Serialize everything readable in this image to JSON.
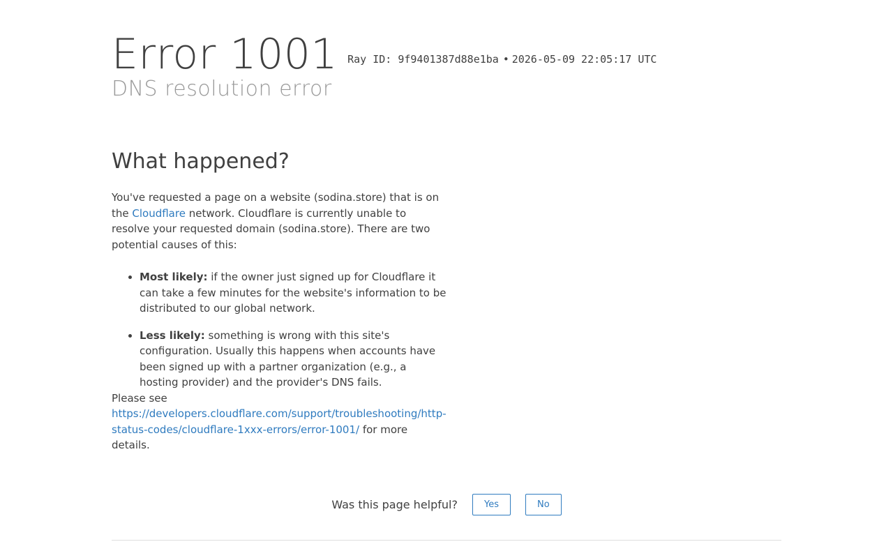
{
  "header": {
    "error_word": "Error",
    "error_code": "1001",
    "ray_label": "Ray ID:",
    "ray_id": "9f9401387d88e1ba",
    "separator": "•",
    "timestamp": "2026-05-09 22:05:17 UTC",
    "subtitle": "DNS resolution error"
  },
  "what_happened": {
    "heading": "What happened?",
    "para_part1": "You've requested a page on a website (sodina.store) that is on the ",
    "cloudflare_link": "Cloudflare",
    "para_part2": " network. Cloudflare is currently unable to resolve your requested domain (sodina.store). There are two potential causes of this:",
    "causes": [
      {
        "label": "Most likely:",
        "text": " if the owner just signed up for Cloudflare it can take a few minutes for the website's information to be distributed to our global network."
      },
      {
        "label": "Less likely:",
        "text": " something is wrong with this site's configuration. Usually this happens when accounts have been signed up with a partner organization (e.g., a hosting provider) and the provider's DNS fails."
      }
    ],
    "see_prefix": "Please see ",
    "see_link": "https://developers.cloudflare.com/support/troubleshooting/http-status-codes/cloudflare-1xxx-errors/error-1001/",
    "see_suffix": " for more details."
  },
  "feedback": {
    "question": "Was this page helpful?",
    "yes_label": "Yes",
    "no_label": "No"
  },
  "colors": {
    "link": "#2f7bbf",
    "text": "#404040",
    "subtitle": "#999999"
  }
}
